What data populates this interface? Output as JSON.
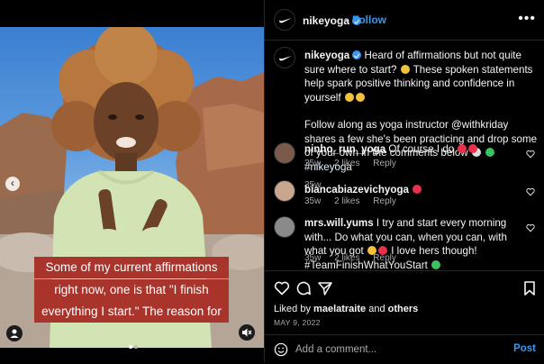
{
  "media": {
    "caption_lines": [
      "Some of my current affirmations",
      "right now, one is that \"I finish",
      "everything I start.\" The reason for"
    ],
    "prev_icon": "chevron-left-icon",
    "tag_icon": "user-tag-icon",
    "mute_icon": "speaker-muted-icon"
  },
  "header": {
    "username": "nikeyoga",
    "separator": "•",
    "follow_label": "Follow",
    "more_label": "•••"
  },
  "caption": {
    "username": "nikeyoga",
    "text1": "Heard of affirmations but not quite sure where to start?",
    "text2": "These spoken statements help spark positive thinking and confidence in yourself",
    "text3": "Follow along as yoga instructor @withkriday shares a few she's been practicing and drop some of your own in the comments below",
    "hashtag": "#nikeyoga",
    "time": "35w"
  },
  "comments": [
    {
      "username": "ninho_run_yoga",
      "text": "Of course I do",
      "time": "35w",
      "likes": "2 likes",
      "reply": "Reply"
    },
    {
      "username": "biancabiazevichyoga",
      "text": "",
      "time": "35w",
      "likes": "2 likes",
      "reply": "Reply"
    },
    {
      "username": "mrs.will.yums",
      "text": "I try and start every morning with... Do what you can, when you can, with what you got",
      "text_b": "I love hers though! #TeamFinishWhatYouStart",
      "time": "35w",
      "likes": "2 likes",
      "reply": "Reply"
    }
  ],
  "actions": {
    "liked_prefix": "Liked by",
    "liked_user": "maelatraite",
    "liked_and": "and",
    "liked_others": "others",
    "date": "MAY 9, 2022"
  },
  "add_comment": {
    "placeholder": "Add a comment...",
    "post_label": "Post"
  },
  "colors": {
    "accent": "#3897f0",
    "caption_bg": "#a8342c",
    "heart_red": "#e8304a",
    "heart_green": "#3cc061"
  }
}
